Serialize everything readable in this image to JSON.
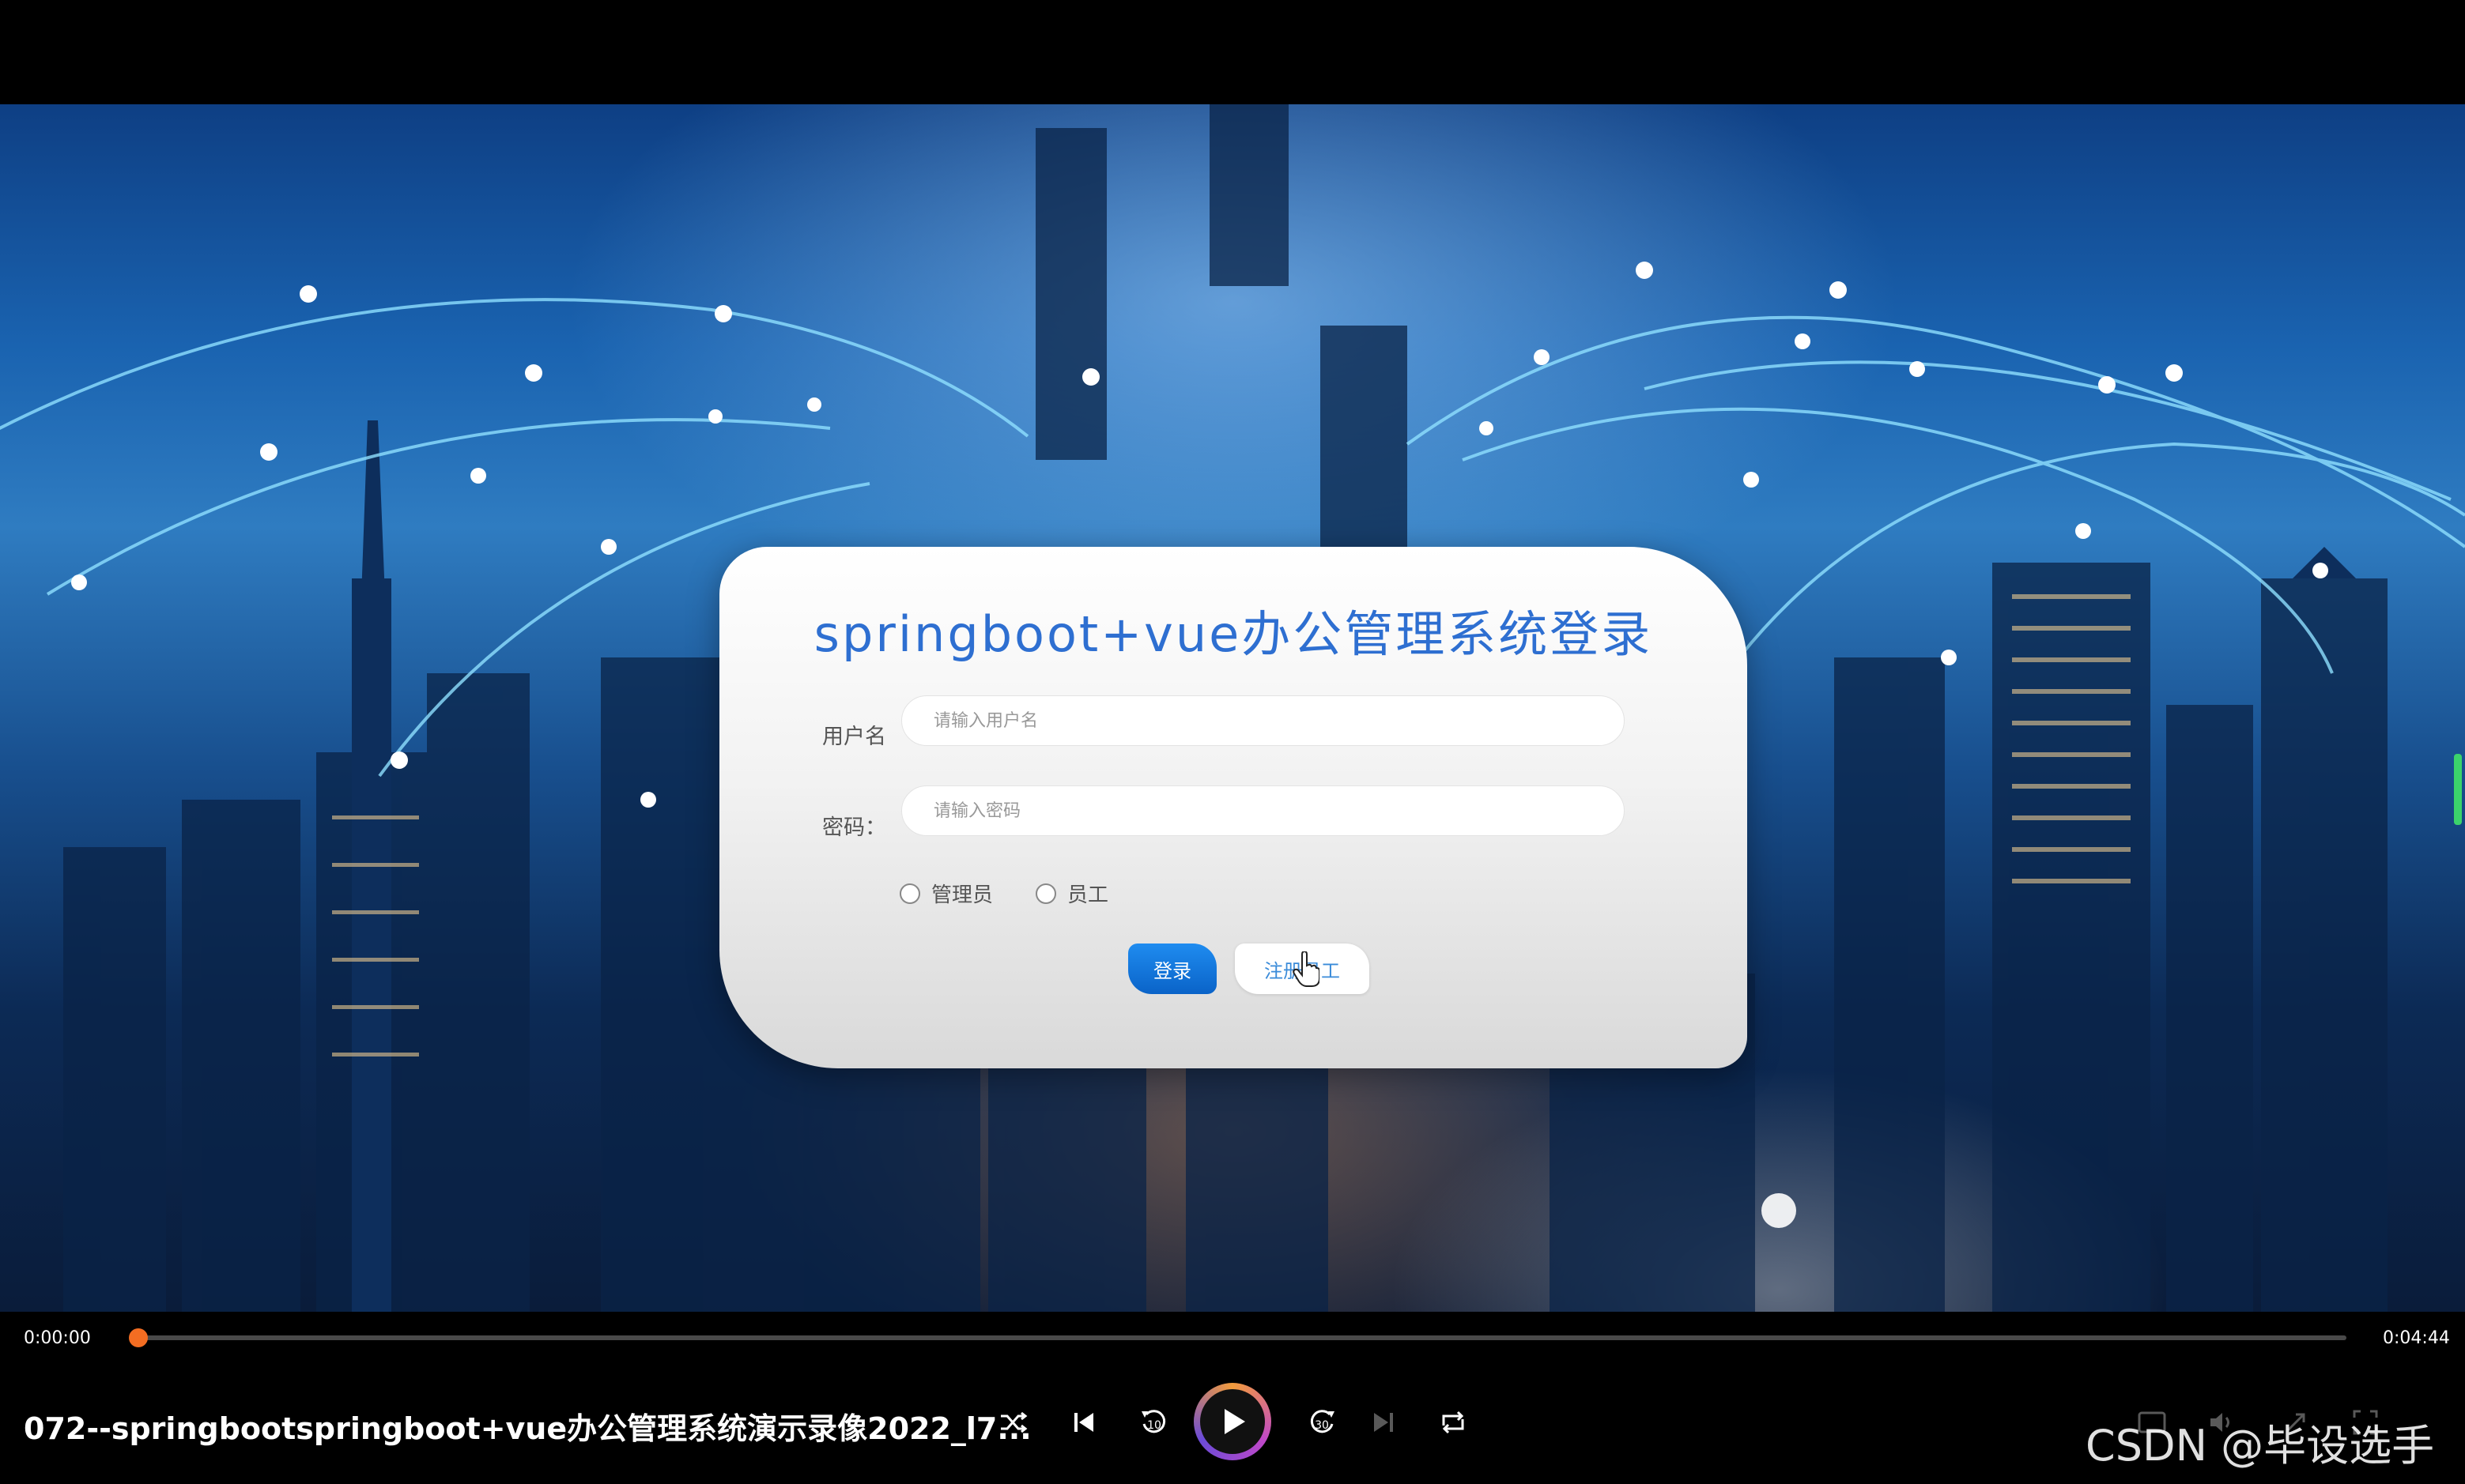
{
  "login": {
    "title": "springboot+vue办公管理系统登录",
    "username_label": "用户名",
    "username_placeholder": "请输入用户名",
    "password_label": "密码：",
    "password_placeholder": "请输入密码",
    "roles": [
      "管理员",
      "员工"
    ],
    "login_button": "登录",
    "register_button": "注册员工"
  },
  "player": {
    "current_time": "0:00:00",
    "total_time": "0:04:44",
    "progress": 0.0,
    "video_title": "072--springbootspringboot+vue办公管理系统演示录像2022_l7...",
    "accent_color": "#f36d22",
    "controls": [
      "shuffle-icon",
      "skip-previous-icon",
      "rewind-10-icon",
      "play-icon",
      "forward-30-icon",
      "skip-next-icon",
      "repeat-icon",
      "subtitles-icon",
      "volume-icon",
      "expand-icon",
      "fullscreen-icon"
    ],
    "rewind_label": "10",
    "forward_label": "30"
  },
  "watermark": "CSDN @毕设选手"
}
